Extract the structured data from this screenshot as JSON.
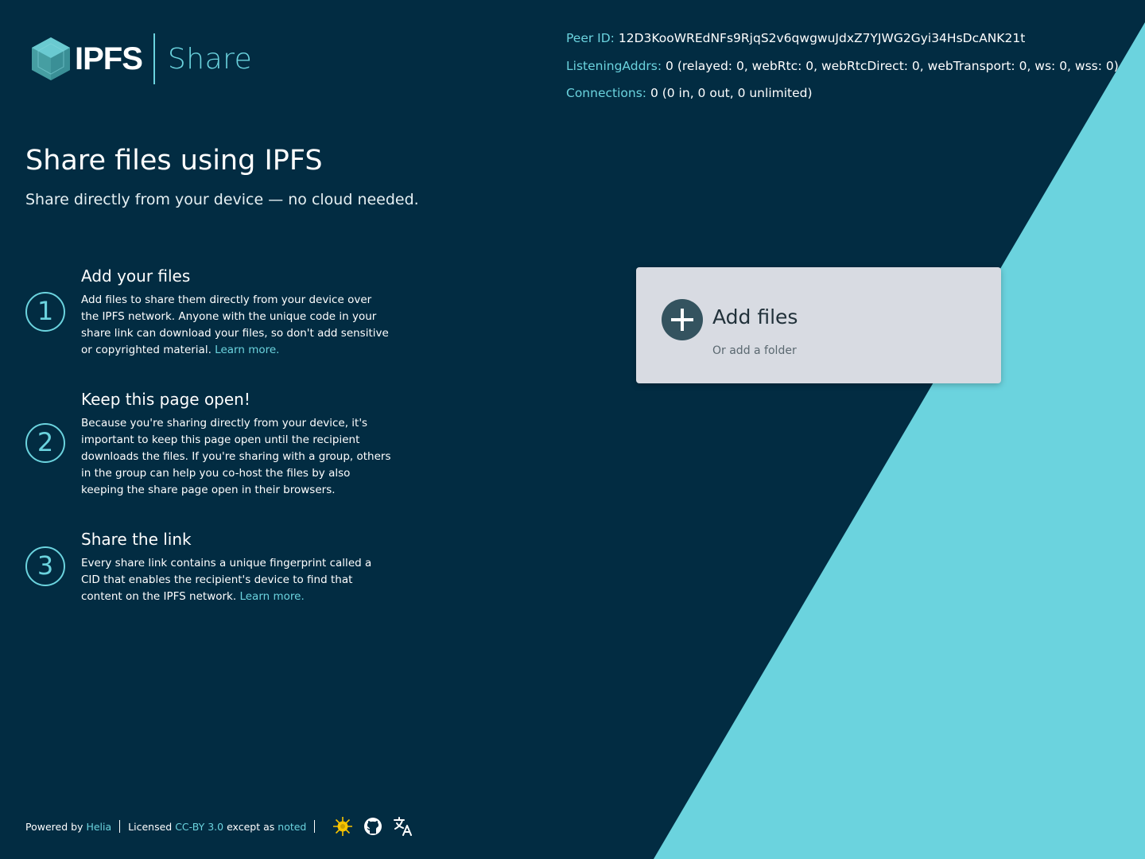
{
  "brand": {
    "logo_text": "IPFS",
    "product": "Share"
  },
  "node_info": {
    "peer_id_label": "Peer ID:",
    "peer_id_value": "12D3KooWREdNFs9RjqS2v6qwgwuJdxZ7YJWG2Gyi34HsDcANK21t",
    "listening_label": "ListeningAddrs:",
    "listening_value": "0 (relayed: 0, webRtc: 0, webRtcDirect: 0, webTransport: 0, ws: 0, wss: 0)",
    "connections_label": "Connections:",
    "connections_value": "0 (0 in, 0 out, 0 unlimited)"
  },
  "hero": {
    "title": "Share files using IPFS",
    "subtitle": "Share directly from your device — no cloud needed."
  },
  "steps": [
    {
      "number": "1",
      "title": "Add your files",
      "text": "Add files to share them directly from your device over the IPFS network. Anyone with the unique code in your share link can download your files, so don't add sensitive or copyrighted material.",
      "link": "Learn more."
    },
    {
      "number": "2",
      "title": "Keep this page open!",
      "text": "Because you're sharing directly from your device, it's important to keep this page open until the recipient downloads the files. If you're sharing with a group, others in the group can help you co-host the files by also keeping the share page open in their browsers."
    },
    {
      "number": "3",
      "title": "Share the link",
      "text": "Every share link contains a unique fingerprint called a CID that enables the recipient's device to find that content on the IPFS network.",
      "link": "Learn more."
    }
  ],
  "add_card": {
    "title": "Add files",
    "folder_link": "Or add a folder"
  },
  "footer": {
    "powered_by": "Powered by",
    "helia_link": "Helia",
    "licensed": "Licensed",
    "license_link": "CC-BY 3.0",
    "except_as": "except as",
    "noted_link": "noted",
    "icons": [
      "helia-sun-icon",
      "github-icon",
      "translate-icon"
    ]
  },
  "colors": {
    "background": "#022c42",
    "accent": "#6bd3de",
    "card": "#d8dbe2",
    "add_button": "#34535f"
  }
}
